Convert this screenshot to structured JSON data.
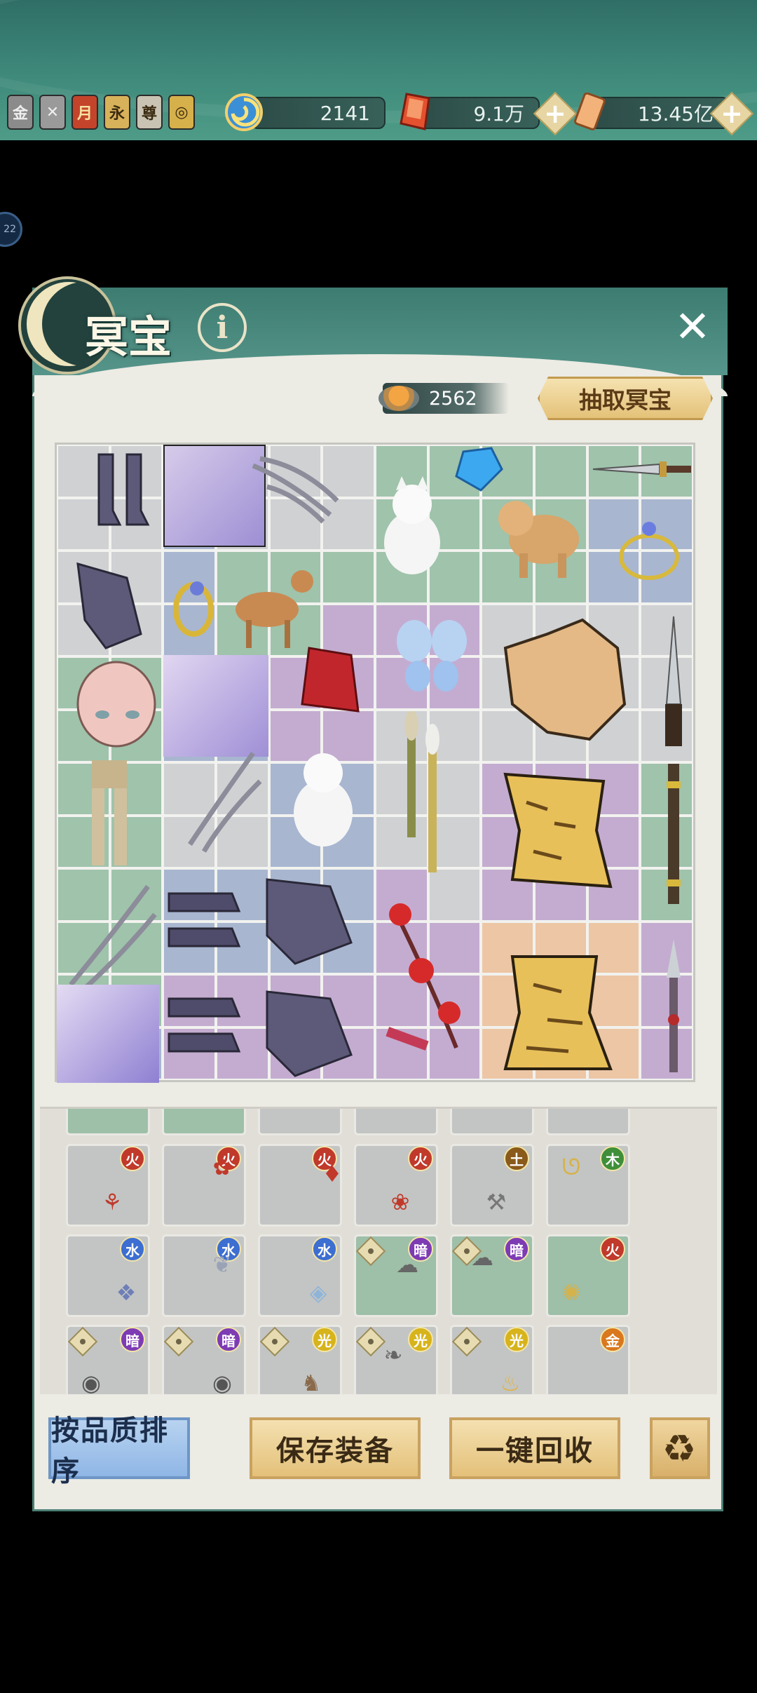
{
  "topbar": {
    "badges": [
      "金",
      "✕",
      "月",
      "永",
      "尊",
      "◎"
    ],
    "resources": [
      {
        "name": "swirl",
        "value": "2141"
      },
      {
        "name": "gem",
        "value": "9.1万"
      },
      {
        "name": "ticket",
        "value": "13.45亿"
      }
    ],
    "side_badge": "22"
  },
  "panel": {
    "title": "冥宝",
    "currency_value": "2562",
    "draw_button": "抽取冥宝"
  },
  "grid": {
    "items": [
      "boots",
      "robe",
      "claws",
      "white-cat",
      "blue-gem",
      "dog",
      "dagger",
      "gauntlet",
      "ring",
      "fawn",
      "circlet",
      "mask",
      "robe",
      "red-cloak",
      "butterfly",
      "fur-pelt",
      "knife",
      "armor-legs",
      "claws",
      "white-cat",
      "brushes",
      "tiger-pelt",
      "rod",
      "claws",
      "boots",
      "gauntlet",
      "maple-branch",
      "robe",
      "boots",
      "gauntlet",
      "tiger-pelt",
      "spear"
    ]
  },
  "inventory": {
    "row1": [
      {
        "elem": "火"
      },
      {
        "elem": "火"
      },
      {
        "elem": "火"
      },
      {
        "elem": "火"
      },
      {
        "elem": "土"
      },
      {
        "elem": "木"
      }
    ],
    "row2": [
      {
        "elem": "水"
      },
      {
        "elem": "水"
      },
      {
        "elem": "水"
      },
      {
        "elem": "暗"
      },
      {
        "elem": "暗"
      },
      {
        "elem": "火"
      }
    ],
    "row3": [
      {
        "elem": "暗"
      },
      {
        "elem": "暗"
      },
      {
        "elem": "光"
      },
      {
        "elem": "光"
      },
      {
        "elem": "光"
      },
      {
        "elem": "金"
      }
    ]
  },
  "buttons": {
    "sort": "按品质排序",
    "save": "保存装备",
    "recycle": "一键回收"
  },
  "colors": {
    "header": "#3d7c71",
    "panel_bg": "#ecebe4",
    "gold_button": "#e4c17a",
    "sort_button": "#8fb6e6"
  }
}
